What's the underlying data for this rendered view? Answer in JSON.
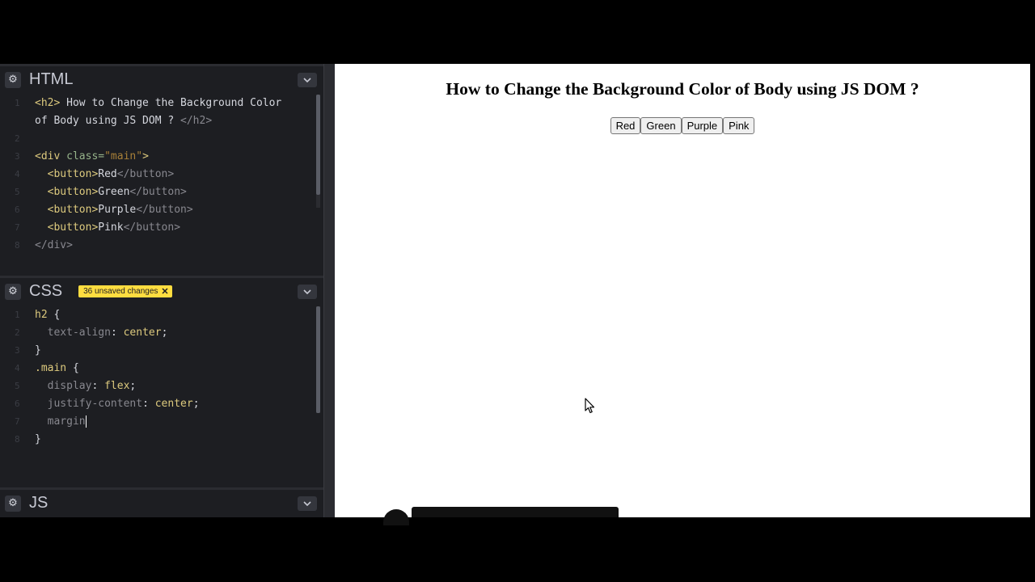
{
  "editor": {
    "html_panel": {
      "title": "HTML",
      "lines": [
        {
          "n": "1",
          "parts": [
            [
              "tag",
              "<h2>"
            ],
            [
              "plain",
              " How to Change the Background Color"
            ]
          ]
        },
        {
          "n": "",
          "parts": [
            [
              "plain",
              "of Body using JS DOM ? "
            ],
            [
              "ctag",
              "</h2>"
            ]
          ]
        },
        {
          "n": "2",
          "parts": []
        },
        {
          "n": "3",
          "parts": [
            [
              "tag",
              "<div "
            ],
            [
              "attr",
              "class="
            ],
            [
              "str",
              "\"main\""
            ],
            [
              "tag",
              ">"
            ]
          ]
        },
        {
          "n": "4",
          "parts": [
            [
              "plain",
              "  "
            ],
            [
              "tag",
              "<button>"
            ],
            [
              "plain",
              "Red"
            ],
            [
              "ctag",
              "</button>"
            ]
          ]
        },
        {
          "n": "5",
          "parts": [
            [
              "plain",
              "  "
            ],
            [
              "tag",
              "<button>"
            ],
            [
              "plain",
              "Green"
            ],
            [
              "ctag",
              "</button>"
            ]
          ]
        },
        {
          "n": "6",
          "parts": [
            [
              "plain",
              "  "
            ],
            [
              "tag",
              "<button>"
            ],
            [
              "plain",
              "Purple"
            ],
            [
              "ctag",
              "</button>"
            ]
          ]
        },
        {
          "n": "7",
          "parts": [
            [
              "plain",
              "  "
            ],
            [
              "tag",
              "<button>"
            ],
            [
              "plain",
              "Pink"
            ],
            [
              "ctag",
              "</button>"
            ]
          ]
        },
        {
          "n": "8",
          "parts": [
            [
              "ctag",
              "</div>"
            ]
          ]
        }
      ]
    },
    "css_panel": {
      "title": "CSS",
      "unsaved_label": "36 unsaved changes",
      "unsaved_close": "✕",
      "lines": [
        {
          "n": "1",
          "parts": [
            [
              "sel",
              "h2"
            ],
            [
              "plain",
              " {"
            ]
          ]
        },
        {
          "n": "2",
          "parts": [
            [
              "plain",
              "  "
            ],
            [
              "prop",
              "text-align"
            ],
            [
              "plain",
              ": "
            ],
            [
              "val",
              "center"
            ],
            [
              "plain",
              ";"
            ]
          ]
        },
        {
          "n": "3",
          "parts": [
            [
              "plain",
              "}"
            ]
          ]
        },
        {
          "n": "4",
          "parts": [
            [
              "sel",
              ".main"
            ],
            [
              "plain",
              " {"
            ]
          ]
        },
        {
          "n": "5",
          "parts": [
            [
              "plain",
              "  "
            ],
            [
              "prop",
              "display"
            ],
            [
              "plain",
              ": "
            ],
            [
              "val",
              "flex"
            ],
            [
              "plain",
              ";"
            ]
          ]
        },
        {
          "n": "6",
          "parts": [
            [
              "plain",
              "  "
            ],
            [
              "prop",
              "justify-content"
            ],
            [
              "plain",
              ": "
            ],
            [
              "val",
              "center"
            ],
            [
              "plain",
              ";"
            ]
          ]
        },
        {
          "n": "7",
          "parts": [
            [
              "plain",
              "  "
            ],
            [
              "prop",
              "margin"
            ]
          ],
          "cursor": true
        },
        {
          "n": "8",
          "parts": [
            [
              "plain",
              "}"
            ]
          ]
        }
      ]
    },
    "js_panel": {
      "title": "JS"
    }
  },
  "preview": {
    "heading": "How to Change the Background Color of Body using JS DOM ?",
    "buttons": [
      "Red",
      "Green",
      "Purple",
      "Pink"
    ]
  },
  "icons": {
    "settings": "gear-icon",
    "collapse": "chevron-down-icon",
    "pointer": "mouse-pointer-icon"
  },
  "colors": {
    "editor_bg": "#1d1e22",
    "tag": "#ddca7e",
    "unsaved_badge": "#ffdd40"
  }
}
